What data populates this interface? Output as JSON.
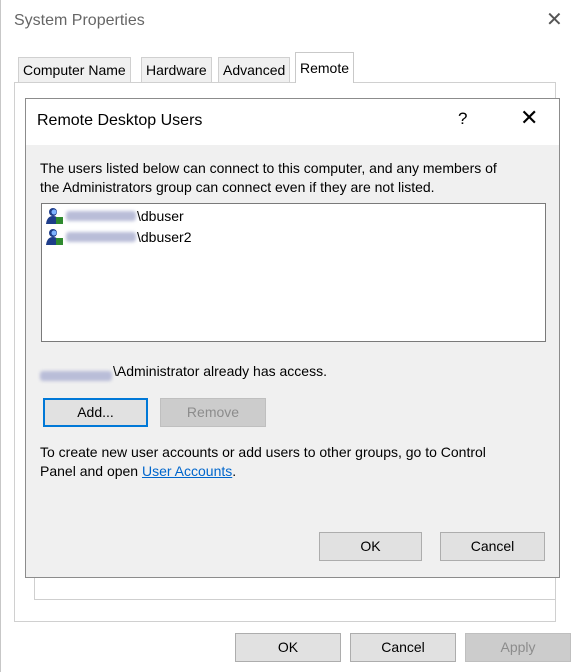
{
  "window": {
    "title": "System Properties",
    "close_glyph": "✕"
  },
  "tabs": [
    {
      "label": "Computer Name"
    },
    {
      "label": "Hardware"
    },
    {
      "label": "Advanced"
    },
    {
      "label": "Remote",
      "selected": true
    }
  ],
  "dialog": {
    "title": "Remote Desktop Users",
    "help_glyph": "?",
    "close_glyph": "✕",
    "description_line1": "The users listed below can connect to this computer, and any members of",
    "description_line2": "the Administrators group can connect even if they are not listed.",
    "users": [
      {
        "domain_redacted": true,
        "name": "\\dbuser",
        "icon": "user-icon"
      },
      {
        "domain_redacted": true,
        "name": "\\dbuser2",
        "icon": "user-icon"
      }
    ],
    "access_text": "\\Administrator already has access.",
    "add_label": "Add...",
    "remove_label": "Remove",
    "info_prefix": "To create new user accounts or add users to other groups, go to Control",
    "info_line2_prefix": "Panel and open ",
    "info_link": "User Accounts",
    "info_suffix": ".",
    "ok_label": "OK",
    "cancel_label": "Cancel"
  },
  "footer": {
    "ok_label": "OK",
    "cancel_label": "Cancel",
    "apply_label": "Apply"
  },
  "colors": {
    "accent": "#0078d7",
    "link": "#0066cc",
    "dialog_bg": "#f0f0f0"
  }
}
